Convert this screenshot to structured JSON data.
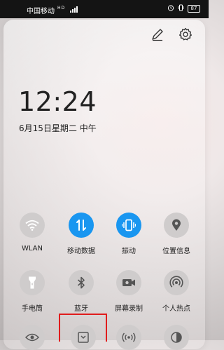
{
  "status_bar": {
    "carrier": "中国移动",
    "sim_tags": "HD",
    "battery": "87"
  },
  "header": {
    "edit_icon": "pencil-icon",
    "settings_icon": "gear-icon"
  },
  "clock": {
    "time": "12:24",
    "date": "6月15日星期二 中午"
  },
  "tiles": [
    {
      "label": "WLAN",
      "icon": "wifi-icon",
      "on": false
    },
    {
      "label": "移动数据",
      "icon": "data-arrows-icon",
      "on": true
    },
    {
      "label": "振动",
      "icon": "vibrate-icon",
      "on": true
    },
    {
      "label": "位置信息",
      "icon": "location-pin-icon",
      "on": false
    },
    {
      "label": "手电筒",
      "icon": "flashlight-icon",
      "on": false
    },
    {
      "label": "蓝牙",
      "icon": "bluetooth-icon",
      "on": false
    },
    {
      "label": "屏幕录制",
      "icon": "video-camera-icon",
      "on": false
    },
    {
      "label": "个人热点",
      "icon": "hotspot-icon",
      "on": false
    }
  ],
  "colors": {
    "accent_on": "#1996f0",
    "tile_off": "#cfcccc",
    "highlight": "#e01c1c"
  }
}
